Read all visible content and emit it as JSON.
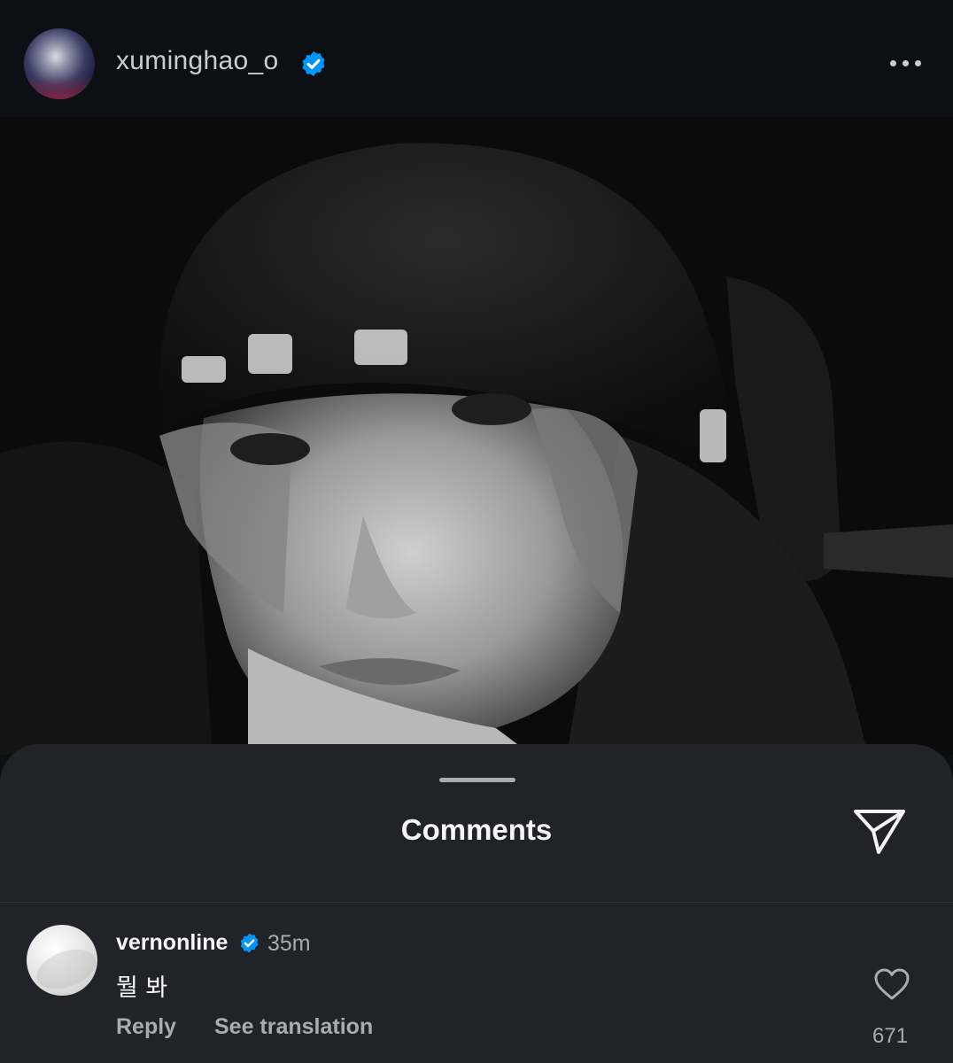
{
  "post": {
    "username": "xuminghao_o",
    "verified": true,
    "more_icon": "more-horizontal-icon"
  },
  "comments_sheet": {
    "title": "Comments",
    "share_icon": "share-send-icon",
    "comments": [
      {
        "username": "vernonline",
        "verified": true,
        "time": "35m",
        "text": "뭘 봐",
        "reply_label": "Reply",
        "translation_label": "See translation",
        "likes": "671"
      }
    ]
  },
  "colors": {
    "background": "#0c1014",
    "sheet": "#212328",
    "verified_blue": "#0095f6",
    "secondary_text": "#a8abb2"
  }
}
